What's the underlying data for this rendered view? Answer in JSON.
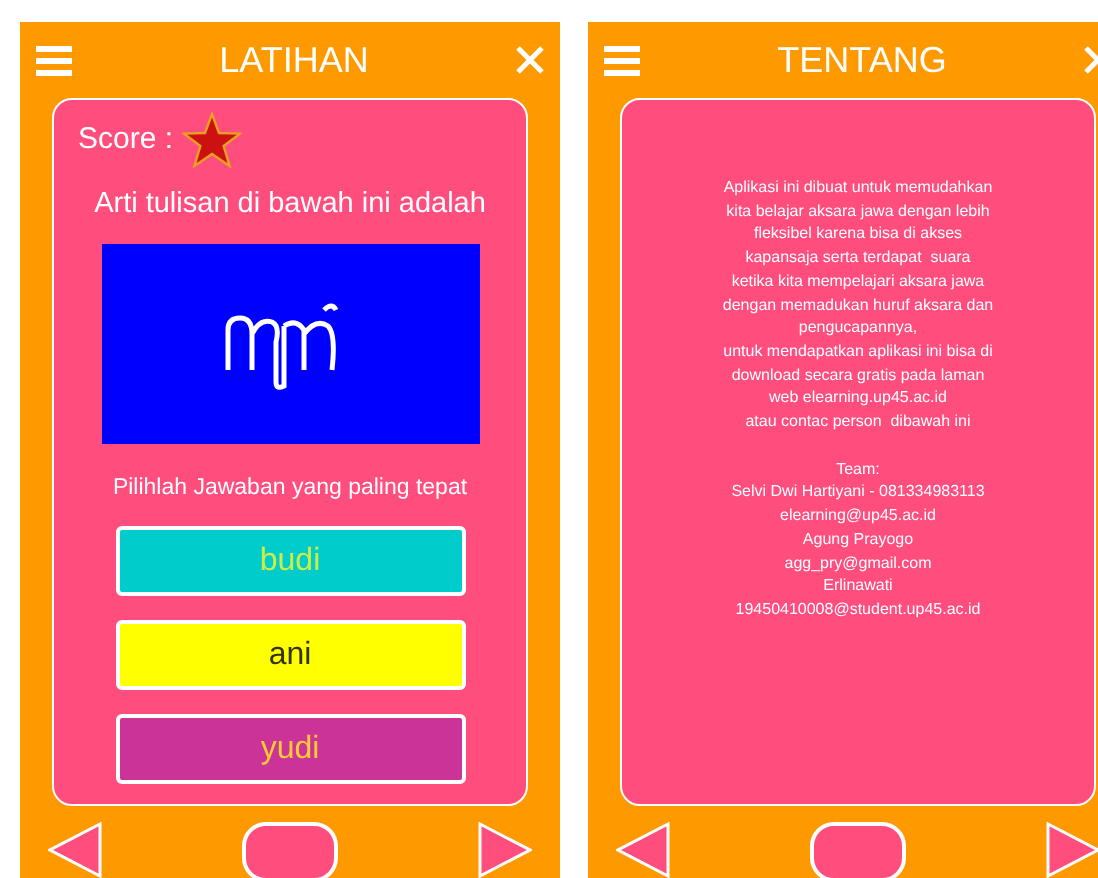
{
  "screens": [
    {
      "kind": "quiz",
      "title": "LATIHAN",
      "score_label": "Score :",
      "question": "Arti tulisan di bawah ini adalah",
      "instruction": "Pilihlah Jawaban yang paling tepat",
      "answers": [
        {
          "label": "budi",
          "color": "#00cccc"
        },
        {
          "label": "ani",
          "color": "#ffff00"
        },
        {
          "label": "yudi",
          "color": "#cc3399"
        }
      ]
    },
    {
      "kind": "about",
      "title": "TENTANG",
      "lines": [
        "Aplikasi ini dibuat untuk memudahkan",
        "kita belajar aksara jawa dengan lebih",
        "fleksibel karena bisa di akses",
        "kapansaja serta terdapat  suara",
        "ketika kita mempelajari aksara jawa",
        "dengan memadukan huruf aksara dan",
        "pengucapannya,",
        "untuk mendapatkan aplikasi ini bisa di",
        "download secara gratis pada laman",
        "web elearning.up45.ac.id",
        "atau contac person  dibawah ini"
      ],
      "team": [
        "Team:",
        "Selvi Dwi Hartiyani - 081334983113",
        "elearning@up45.ac.id",
        "Agung Prayogo",
        "agg_pry@gmail.com",
        "Erlinawati",
        "19450410008@student.up45.ac.id"
      ]
    }
  ]
}
